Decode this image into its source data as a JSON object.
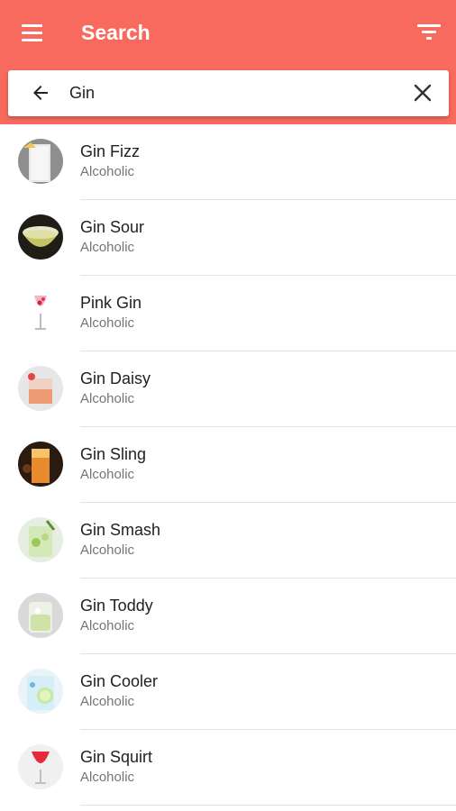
{
  "appbar": {
    "title": "Search",
    "menu_icon": "hamburger-menu-icon",
    "filter_icon": "filter-icon",
    "color": "#f96a5e"
  },
  "search": {
    "value": "Gin",
    "back_icon": "arrow-back-icon",
    "clear_icon": "close-icon"
  },
  "results": [
    {
      "name": "Gin Fizz",
      "category": "Alcoholic"
    },
    {
      "name": "Gin Sour",
      "category": "Alcoholic"
    },
    {
      "name": "Pink Gin",
      "category": "Alcoholic"
    },
    {
      "name": "Gin Daisy",
      "category": "Alcoholic"
    },
    {
      "name": "Gin Sling",
      "category": "Alcoholic"
    },
    {
      "name": "Gin Smash",
      "category": "Alcoholic"
    },
    {
      "name": "Gin Toddy",
      "category": "Alcoholic"
    },
    {
      "name": "Gin Cooler",
      "category": "Alcoholic"
    },
    {
      "name": "Gin Squirt",
      "category": "Alcoholic"
    }
  ]
}
